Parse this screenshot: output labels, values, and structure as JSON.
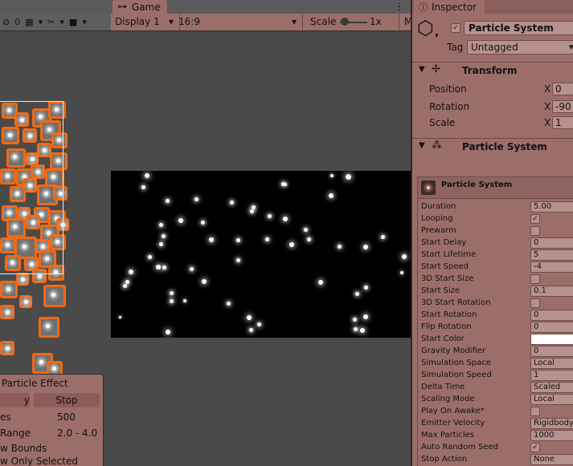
{
  "scene": {
    "toolbar": {
      "gizmo_count": "0",
      "glyph_tools": "✂",
      "glyph_camera": "■"
    },
    "particle_effect": {
      "title": "Particle Effect",
      "play_label": "y",
      "stop_label": "Stop",
      "rows": [
        {
          "label": "es",
          "value": "500"
        },
        {
          "label": "Range",
          "value": "2.0 - 4.0"
        },
        {
          "label": "w Bounds",
          "value": ""
        },
        {
          "label": "w Only Selected",
          "value": ""
        }
      ]
    }
  },
  "game": {
    "tab_label": "Game",
    "display": "Display 1",
    "aspect": "16:9",
    "scale_label": "Scale",
    "scale_value": "1x",
    "trailing": "M"
  },
  "inspector": {
    "tab_label": "Inspector",
    "object_name": "Particle System",
    "tag_label": "Tag",
    "tag_value": "Untagged",
    "transform": {
      "title": "Transform",
      "position_label": "Position",
      "position_x": "0",
      "rotation_label": "Rotation",
      "rotation_x": "-90",
      "scale_label": "Scale",
      "scale_x": "1",
      "axis_x": "X"
    },
    "component_title": "Particle System",
    "module_title": "Particle System",
    "properties": [
      {
        "label": "Duration",
        "value": "5.00",
        "type": "field"
      },
      {
        "label": "Looping",
        "value": "✓",
        "type": "check"
      },
      {
        "label": "Prewarm",
        "value": "",
        "type": "check"
      },
      {
        "label": "Start Delay",
        "value": "0",
        "type": "field"
      },
      {
        "label": "Start Lifetime",
        "value": "5",
        "type": "field"
      },
      {
        "label": "Start Speed",
        "value": "-4",
        "type": "field"
      },
      {
        "label": "3D Start Size",
        "value": "",
        "type": "check"
      },
      {
        "label": "Start Size",
        "value": "0.1",
        "type": "field"
      },
      {
        "label": "3D Start Rotation",
        "value": "",
        "type": "check"
      },
      {
        "label": "Start Rotation",
        "value": "0",
        "type": "field"
      },
      {
        "label": "Flip Rotation",
        "value": "0",
        "type": "field"
      },
      {
        "label": "Start Color",
        "value": "",
        "type": "color"
      },
      {
        "label": "Gravity Modifier",
        "value": "0",
        "type": "field"
      },
      {
        "label": "Simulation Space",
        "value": "Local",
        "type": "field"
      },
      {
        "label": "Simulation Speed",
        "value": "1",
        "type": "field"
      },
      {
        "label": "Delta Time",
        "value": "Scaled",
        "type": "field"
      },
      {
        "label": "Scaling Mode",
        "value": "Local",
        "type": "field"
      },
      {
        "label": "Play On Awake*",
        "value": "",
        "type": "check"
      },
      {
        "label": "Emitter Velocity",
        "value": "Rigidbody",
        "type": "field"
      },
      {
        "label": "Max Particles",
        "value": "1000",
        "type": "field"
      },
      {
        "label": "Auto Random Seed",
        "value": "✓",
        "type": "check"
      },
      {
        "label": "Stop Action",
        "value": "None",
        "type": "field"
      }
    ]
  },
  "colors": {
    "accent_orange": "#f06a14",
    "panel": "#9c6e6a",
    "start_color": "#ffffff"
  }
}
